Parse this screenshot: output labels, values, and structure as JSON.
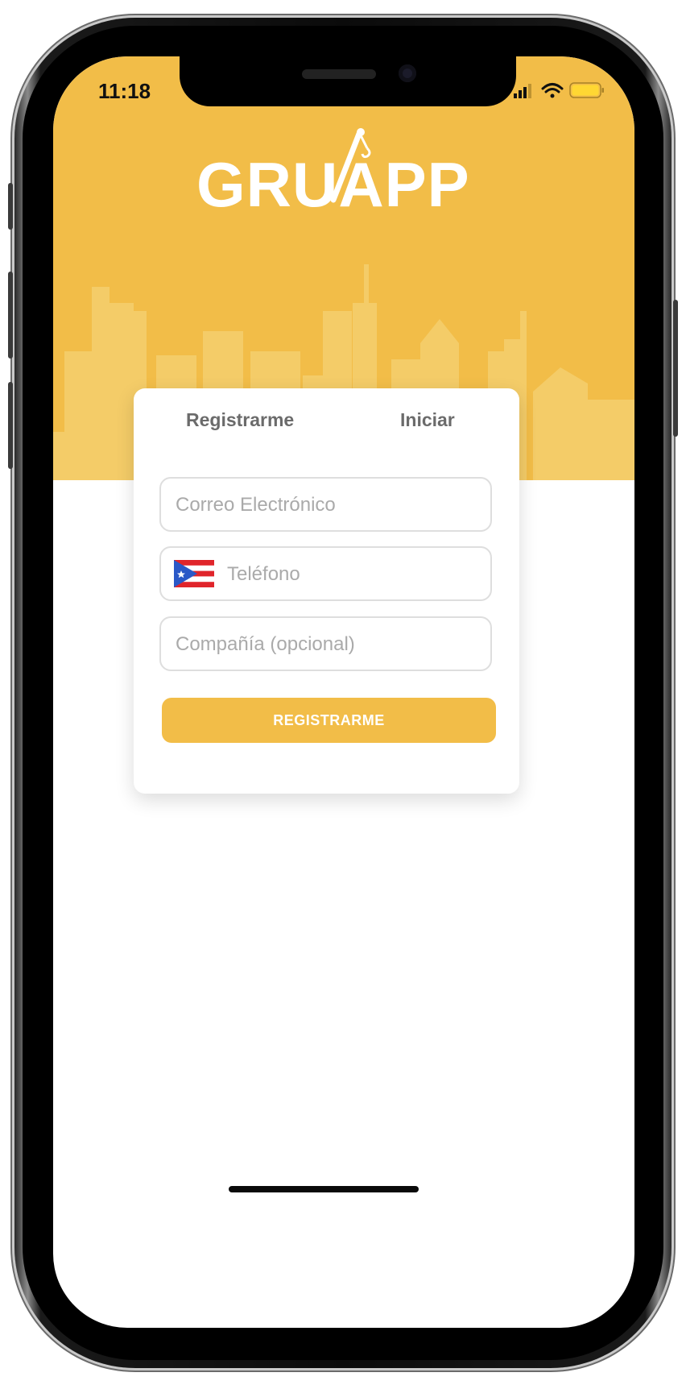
{
  "status_bar": {
    "time": "11:18",
    "icons": [
      "cellular-signal-icon",
      "wifi-icon",
      "battery-icon"
    ]
  },
  "brand": {
    "name": "GRUAPP",
    "primary_color": "#f2bd48"
  },
  "auth_tabs": {
    "register_label": "Registrarme",
    "login_label": "Iniciar"
  },
  "form": {
    "email_placeholder": "Correo Electrónico",
    "phone_placeholder": "Teléfono",
    "phone_country_icon": "puerto-rico-flag-icon",
    "company_placeholder": "Compañía (opcional)",
    "submit_label": "REGISTRARME"
  }
}
